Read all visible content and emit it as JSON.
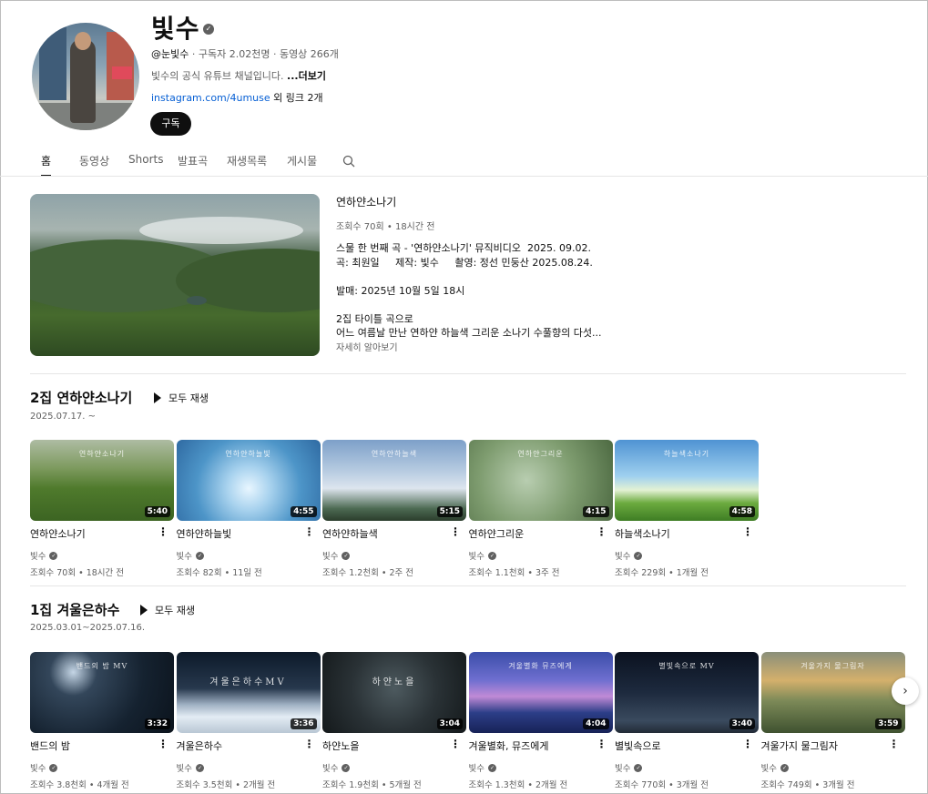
{
  "channel": {
    "name": "빛수",
    "handle": "@눈빛수",
    "meta": " · 구독자 2.02천명 · 동영상 266개",
    "description": "빛수의 공식 유튜브 채널입니다. ",
    "more": "...더보기",
    "link": "instagram.com/4umuse",
    "link_suffix": " 외 링크 2개",
    "subscribe": "구독"
  },
  "tabs": [
    "홈",
    "동영상",
    "Shorts",
    "발표곡",
    "재생목록",
    "게시물"
  ],
  "featured": {
    "title": "연하얀소나기",
    "views": "조회수 70회 • 18시간 전",
    "description": "스물 한 번째 곡 - '연하얀소나기' 뮤직비디오  2025. 09.02.\n곡: 최원일     제작: 빛수     촬영: 정선 민둥산 2025.08.24.\n\n발매: 2025년 10월 5일 18시\n\n2집 타이틀 곡으로\n어느 여름날 만난 연하얀 하늘색 그리운 소나기 수풀향의 다섯...",
    "more": "자세히 알아보기"
  },
  "sections": [
    {
      "title": "2집 연하얀소나기",
      "play_all": "모두 재생",
      "subtitle": "2025.07.17. ~",
      "videos": [
        {
          "title": "연하얀소나기",
          "caption": "연하얀소나기",
          "duration": "5:40",
          "channel": "빛수",
          "stats": "조회수 70회 • 18시간 전",
          "bg": "bg-green"
        },
        {
          "title": "연하얀하늘빛",
          "caption": "연하얀하늘빛",
          "duration": "4:55",
          "channel": "빛수",
          "stats": "조회수 82회 • 11일 전",
          "bg": "bg-sky"
        },
        {
          "title": "연하얀하늘색",
          "caption": "연하얀하늘색",
          "duration": "5:15",
          "channel": "빛수",
          "stats": "조회수 1.2천회 • 2주 전",
          "bg": "bg-cloud"
        },
        {
          "title": "연하얀그리운",
          "caption": "연하얀그리운",
          "duration": "4:15",
          "channel": "빛수",
          "stats": "조회수 1.1천회 • 3주 전",
          "bg": "bg-doll"
        },
        {
          "title": "하늘색소나기",
          "caption": "하늘색소나기",
          "duration": "4:58",
          "channel": "빛수",
          "stats": "조회수 229회 • 1개월 전",
          "bg": "bg-field"
        }
      ]
    },
    {
      "title": "1집 겨울은하수",
      "play_all": "모두 재생",
      "subtitle": "2025.03.01~2025.07.16.",
      "videos": [
        {
          "title": "밴드의 밤",
          "caption": "밴드의 밤 MV",
          "duration": "3:32",
          "channel": "빛수",
          "stats": "조회수 3.8천회 • 4개월 전",
          "bg": "bg-night"
        },
        {
          "title": "겨울은하수",
          "caption": "겨울은하수MV",
          "duration": "3:36",
          "channel": "빛수",
          "stats": "조회수 3.5천회 • 2개월 전",
          "bg": "bg-snow"
        },
        {
          "title": "하얀노을",
          "caption": "하얀노을",
          "duration": "3:04",
          "channel": "빛수",
          "stats": "조회수 1.9천회 • 5개월 전",
          "bg": "bg-dark"
        },
        {
          "title": "겨울별화, 뮤즈에게",
          "caption": "겨울별화 뮤즈에게",
          "duration": "4:04",
          "channel": "빛수",
          "stats": "조회수 1.3천회 • 2개월 전",
          "bg": "bg-blue"
        },
        {
          "title": "별빛속으로",
          "caption": "별빛속으로 MV",
          "duration": "3:40",
          "channel": "빛수",
          "stats": "조회수 770회 • 3개월 전",
          "bg": "bg-stars"
        },
        {
          "title": "겨울가지 물그림자",
          "caption": "겨울가지 물그림자",
          "duration": "3:59",
          "channel": "빛수",
          "stats": "조회수 749회 • 3개월 전",
          "bg": "bg-sunset"
        }
      ]
    }
  ]
}
